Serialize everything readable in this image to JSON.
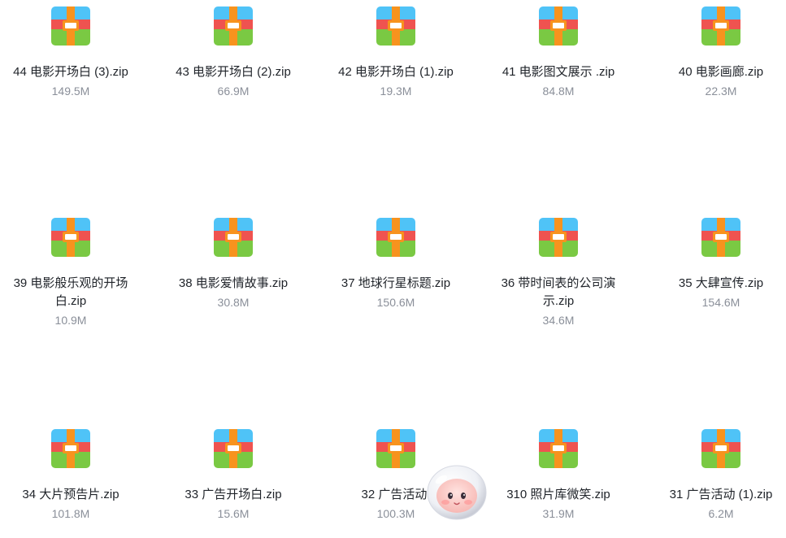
{
  "files": [
    {
      "name": "44 电影开场白 (3).zip",
      "size": "149.5M"
    },
    {
      "name": "43 电影开场白 (2).zip",
      "size": "66.9M"
    },
    {
      "name": "42 电影开场白 (1).zip",
      "size": "19.3M"
    },
    {
      "name": "41 电影图文展示 .zip",
      "size": "84.8M"
    },
    {
      "name": "40 电影画廊.zip",
      "size": "22.3M"
    },
    {
      "name": "39 电影般乐观的开场白.zip",
      "size": "10.9M"
    },
    {
      "name": "38 电影爱情故事.zip",
      "size": "30.8M"
    },
    {
      "name": "37 地球行星标题.zip",
      "size": "150.6M"
    },
    {
      "name": "36 带时间表的公司演示.zip",
      "size": "34.6M"
    },
    {
      "name": "35 大肆宣传.zip",
      "size": "154.6M"
    },
    {
      "name": "34 大片预告片.zip",
      "size": "101.8M"
    },
    {
      "name": "33 广告开场白.zip",
      "size": "15.6M"
    },
    {
      "name": "32 广告活动.",
      "size": "100.3M"
    },
    {
      "name": "310 照片库微笑.zip",
      "size": "31.9M"
    },
    {
      "name": "31 广告活动 (1).zip",
      "size": "6.2M"
    }
  ],
  "icons": {
    "file": "zip-archive-icon",
    "mascot": "astronaut-mascot-icon"
  },
  "colors": {
    "text": "#1f2329",
    "size_text": "#8a8f99",
    "zip_top": "#4fc3f7",
    "zip_mid": "#ef5350",
    "zip_bottom": "#7ac943",
    "zip_strap": "#f7931e"
  }
}
